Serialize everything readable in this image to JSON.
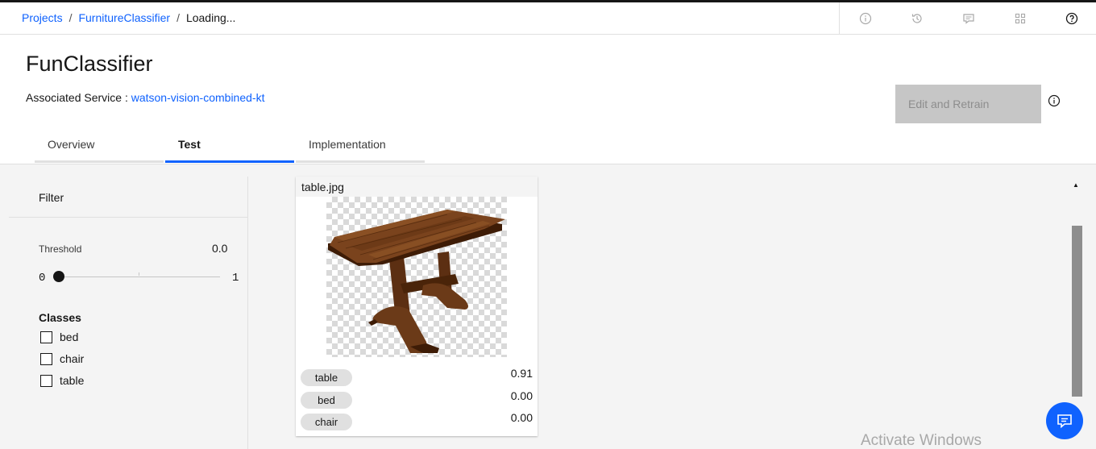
{
  "breadcrumb": {
    "items": [
      "Projects",
      "FurnitureClassifier"
    ],
    "separator": "/",
    "current": "Loading..."
  },
  "header_icons": [
    "info-icon",
    "history-icon",
    "chat-icon",
    "apps-icon",
    "help-icon"
  ],
  "page": {
    "title": "FunClassifier",
    "associated_label": "Associated Service :",
    "service_name": "watson-vision-combined-kt",
    "retrain_label": "Edit and Retrain"
  },
  "tabs": [
    {
      "label": "Overview",
      "active": false
    },
    {
      "label": "Test",
      "active": true
    },
    {
      "label": "Implementation",
      "active": false
    }
  ],
  "filter": {
    "title": "Filter",
    "threshold_label": "Threshold",
    "threshold_value": "0.0",
    "slider_min": "0",
    "slider_max": "1",
    "slider_position": 0.0,
    "classes_title": "Classes",
    "classes": [
      {
        "label": "bed",
        "checked": false
      },
      {
        "label": "chair",
        "checked": false
      },
      {
        "label": "table",
        "checked": false
      }
    ]
  },
  "result": {
    "filename": "table.jpg",
    "scores": [
      {
        "class": "table",
        "score": "0.91"
      },
      {
        "class": "bed",
        "score": "0.00"
      },
      {
        "class": "chair",
        "score": "0.00"
      }
    ]
  },
  "watermark": "Activate Windows",
  "colors": {
    "accent": "#0f62fe",
    "panel_bg": "#f4f4f4",
    "disabled_button": "#c6c6c6"
  }
}
